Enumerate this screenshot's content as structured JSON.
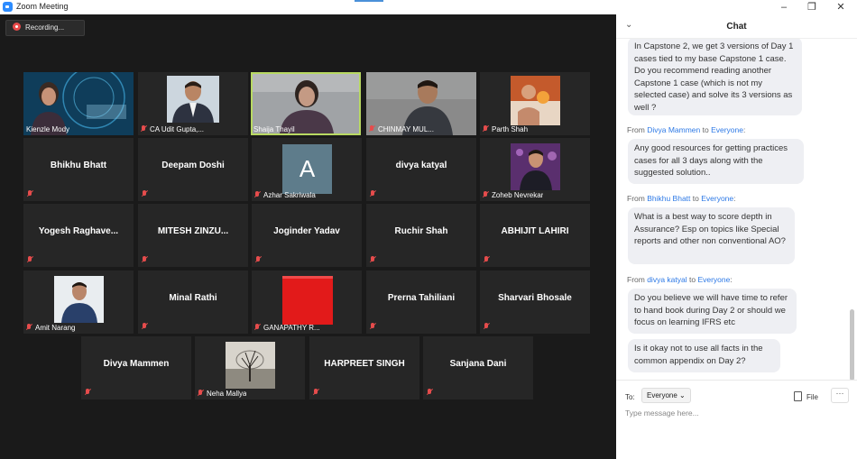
{
  "window": {
    "title": "Zoom Meeting",
    "minimize": "–",
    "restore": "❐",
    "close": "✕"
  },
  "recording": {
    "label": "Recording..."
  },
  "participants": [
    {
      "name": "Kienzle Mody",
      "photo": "video",
      "muted": false
    },
    {
      "name": "CA Udit Gupta,...",
      "photo": "video",
      "muted": true
    },
    {
      "name": "Shaija Thayil",
      "photo": "video",
      "muted": false,
      "active_speaker": true
    },
    {
      "name": "CHINMAY MUL...",
      "photo": "video",
      "muted": true
    },
    {
      "name": "Parth Shah",
      "photo": "video",
      "muted": true
    },
    {
      "name": "Bhikhu Bhatt",
      "muted": true
    },
    {
      "name": "Deepam Doshi",
      "muted": true
    },
    {
      "name": "Azhar Sakriwala",
      "avatar_letter": "A",
      "muted": true
    },
    {
      "name": "divya katyal",
      "muted": true
    },
    {
      "name": "Zoheb Nevrekar",
      "photo": "video",
      "muted": true
    },
    {
      "name": "Yogesh  Raghave...",
      "muted": true
    },
    {
      "name": "MITESH  ZINZU...",
      "muted": true
    },
    {
      "name": "Joginder Yadav",
      "muted": true
    },
    {
      "name": "Ruchir Shah",
      "muted": true
    },
    {
      "name": "ABHIJIT LAHIRI",
      "muted": true
    },
    {
      "name": "Amit Narang",
      "photo": "video",
      "muted": true
    },
    {
      "name": "Minal Rathi",
      "muted": true
    },
    {
      "name": "GANAPATHY R...",
      "photo": "video",
      "muted": true
    },
    {
      "name": "Prerna Tahiliani",
      "muted": true
    },
    {
      "name": "Sharvari Bhosale",
      "muted": true
    },
    {
      "name": "Divya Mammen",
      "muted": true
    },
    {
      "name": "Neha Mallya",
      "photo": "video",
      "muted": true
    },
    {
      "name": "HARPREET SINGH",
      "muted": true
    },
    {
      "name": "Sanjana Dani",
      "muted": true
    }
  ],
  "chat": {
    "title": "Chat",
    "collapse_icon": "chevron-down-icon",
    "messages": [
      {
        "text": "In Capstone 2, we get 3 versions of Day 1 cases tied to my base Capstone 1 case. Do you recommend reading another Capstone 1 case (which is not my selected case) and solve its 3 versions as well ?"
      },
      {
        "from_prefix": "From ",
        "sender": "Divya Mammen",
        "to_word": " to ",
        "recipient": "Everyone",
        "colon": ":",
        "text": "Any good resources for getting practices cases for all 3 days along with the suggested solution.."
      },
      {
        "from_prefix": "From ",
        "sender": "Bhikhu Bhatt",
        "to_word": " to ",
        "recipient": "Everyone",
        "colon": ":",
        "text": "What is a best way to score depth in Assurance? Esp on topics like Special reports and other non conventional AO?"
      },
      {
        "from_prefix": "From ",
        "sender": "divya katyal",
        "to_word": " to ",
        "recipient": "Everyone",
        "colon": ":",
        "text": "Do you believe we will have time to refer to hand book during Day 2 or should we focus on learning IFRS etc"
      },
      {
        "text": "Is it okay not to use all facts in the common appendix on Day 2?"
      }
    ],
    "composer": {
      "to_label": "To:",
      "recipient": "Everyone",
      "file_label": "File",
      "more_label": "···",
      "placeholder": "Type message here..."
    }
  }
}
